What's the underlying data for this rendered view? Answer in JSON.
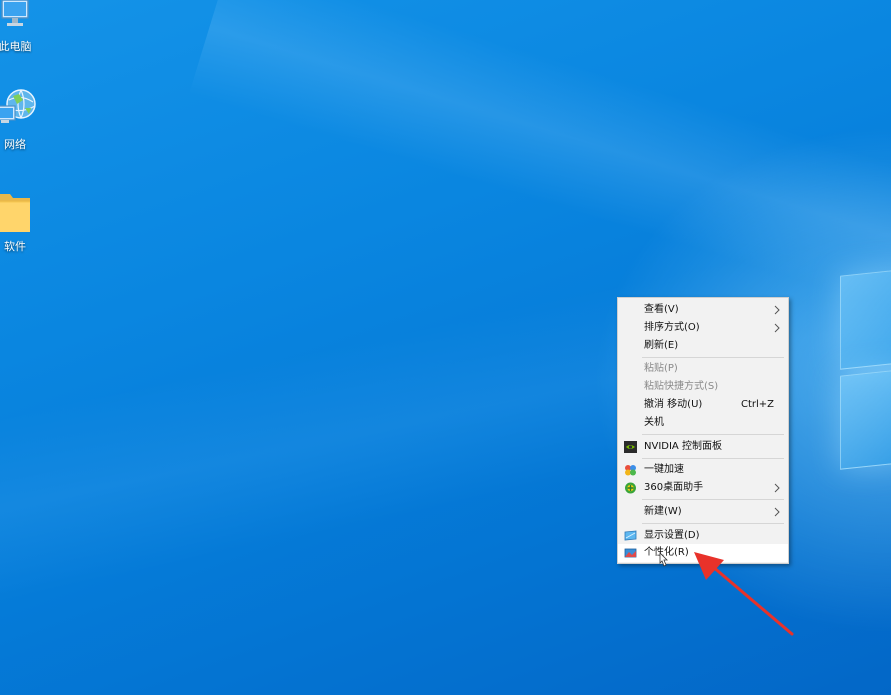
{
  "desktop": {
    "icons": [
      {
        "label": "此电脑",
        "icon": "computer-icon"
      },
      {
        "label": "网络",
        "icon": "network-globe-icon"
      },
      {
        "label": "软件",
        "icon": "folder-icon"
      }
    ],
    "accent": "#0a86e0"
  },
  "context_menu": {
    "items": [
      {
        "label": "查看(V)",
        "submenu": true
      },
      {
        "label": "排序方式(O)",
        "submenu": true
      },
      {
        "label": "刷新(E)"
      },
      {
        "label": "粘贴(P)",
        "disabled": true
      },
      {
        "label": "粘贴快捷方式(S)",
        "disabled": true
      },
      {
        "label": "撤消 移动(U)",
        "shortcut": "Ctrl+Z"
      },
      {
        "label": "关机"
      },
      {
        "label": "NVIDIA 控制面板",
        "icon": "nvidia-icon"
      },
      {
        "label": "一键加速",
        "icon": "boost-icon"
      },
      {
        "label": "360桌面助手",
        "icon": "360-icon",
        "submenu": true
      },
      {
        "label": "新建(W)",
        "submenu": true
      },
      {
        "label": "显示设置(D)",
        "icon": "display-icon"
      },
      {
        "label": "个性化(R)",
        "icon": "personalize-icon",
        "highlighted": true
      }
    ]
  },
  "annotation": {
    "arrow_color": "#e8322a",
    "points_to": "个性化(R)"
  }
}
